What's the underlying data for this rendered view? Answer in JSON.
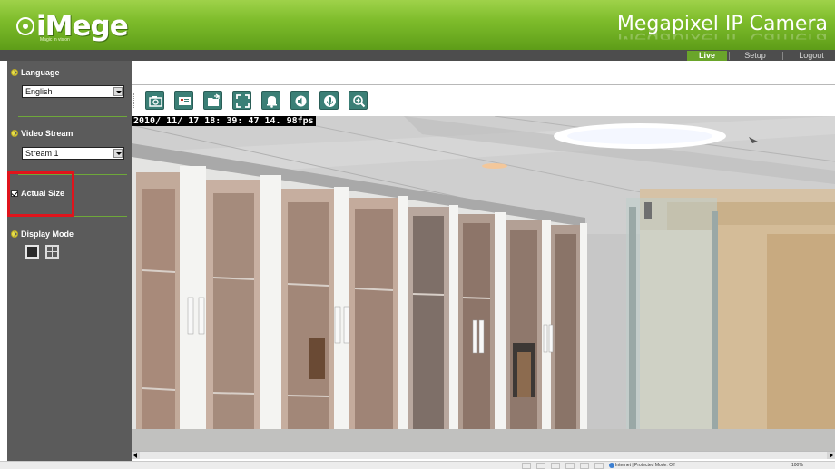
{
  "header": {
    "logo_text": "iMege",
    "logo_tagline": "Magic in vision",
    "product_title": "Megapixel IP Camera",
    "background_color": "#7fbd2c"
  },
  "nav": {
    "tabs": [
      {
        "label": "Live",
        "active": true
      },
      {
        "label": "Setup",
        "active": false
      },
      {
        "label": "Logout",
        "active": false
      }
    ],
    "active_color": "#6aa52a"
  },
  "sidebar": {
    "language": {
      "title": "Language",
      "selected": "English"
    },
    "video_stream": {
      "title": "Video Stream",
      "selected": "Stream 1"
    },
    "actual_size": {
      "label": "Actual Size",
      "checked": true
    },
    "display_mode": {
      "title": "Display Mode",
      "options": [
        "single-view-icon",
        "quad-view-icon"
      ],
      "selected": "single"
    },
    "background_color": "#5b5b5b",
    "highlight_color": "#e0141c"
  },
  "toolbar": {
    "buttons": [
      {
        "icon": "snapshot-camera-icon"
      },
      {
        "icon": "record-video-icon"
      },
      {
        "icon": "open-folder-icon"
      },
      {
        "icon": "fullscreen-icon"
      },
      {
        "icon": "alarm-bell-icon"
      },
      {
        "icon": "speaker-icon"
      },
      {
        "icon": "microphone-icon"
      },
      {
        "icon": "zoom-in-icon"
      }
    ],
    "button_color": "#3b7f76"
  },
  "video": {
    "osd_timestamp": "2010/ 11/ 17  18: 39: 47  14. 98fps"
  },
  "statusbar": {
    "zone_text": "Internet | Protected Mode: Off",
    "zoom_text": "100%"
  }
}
